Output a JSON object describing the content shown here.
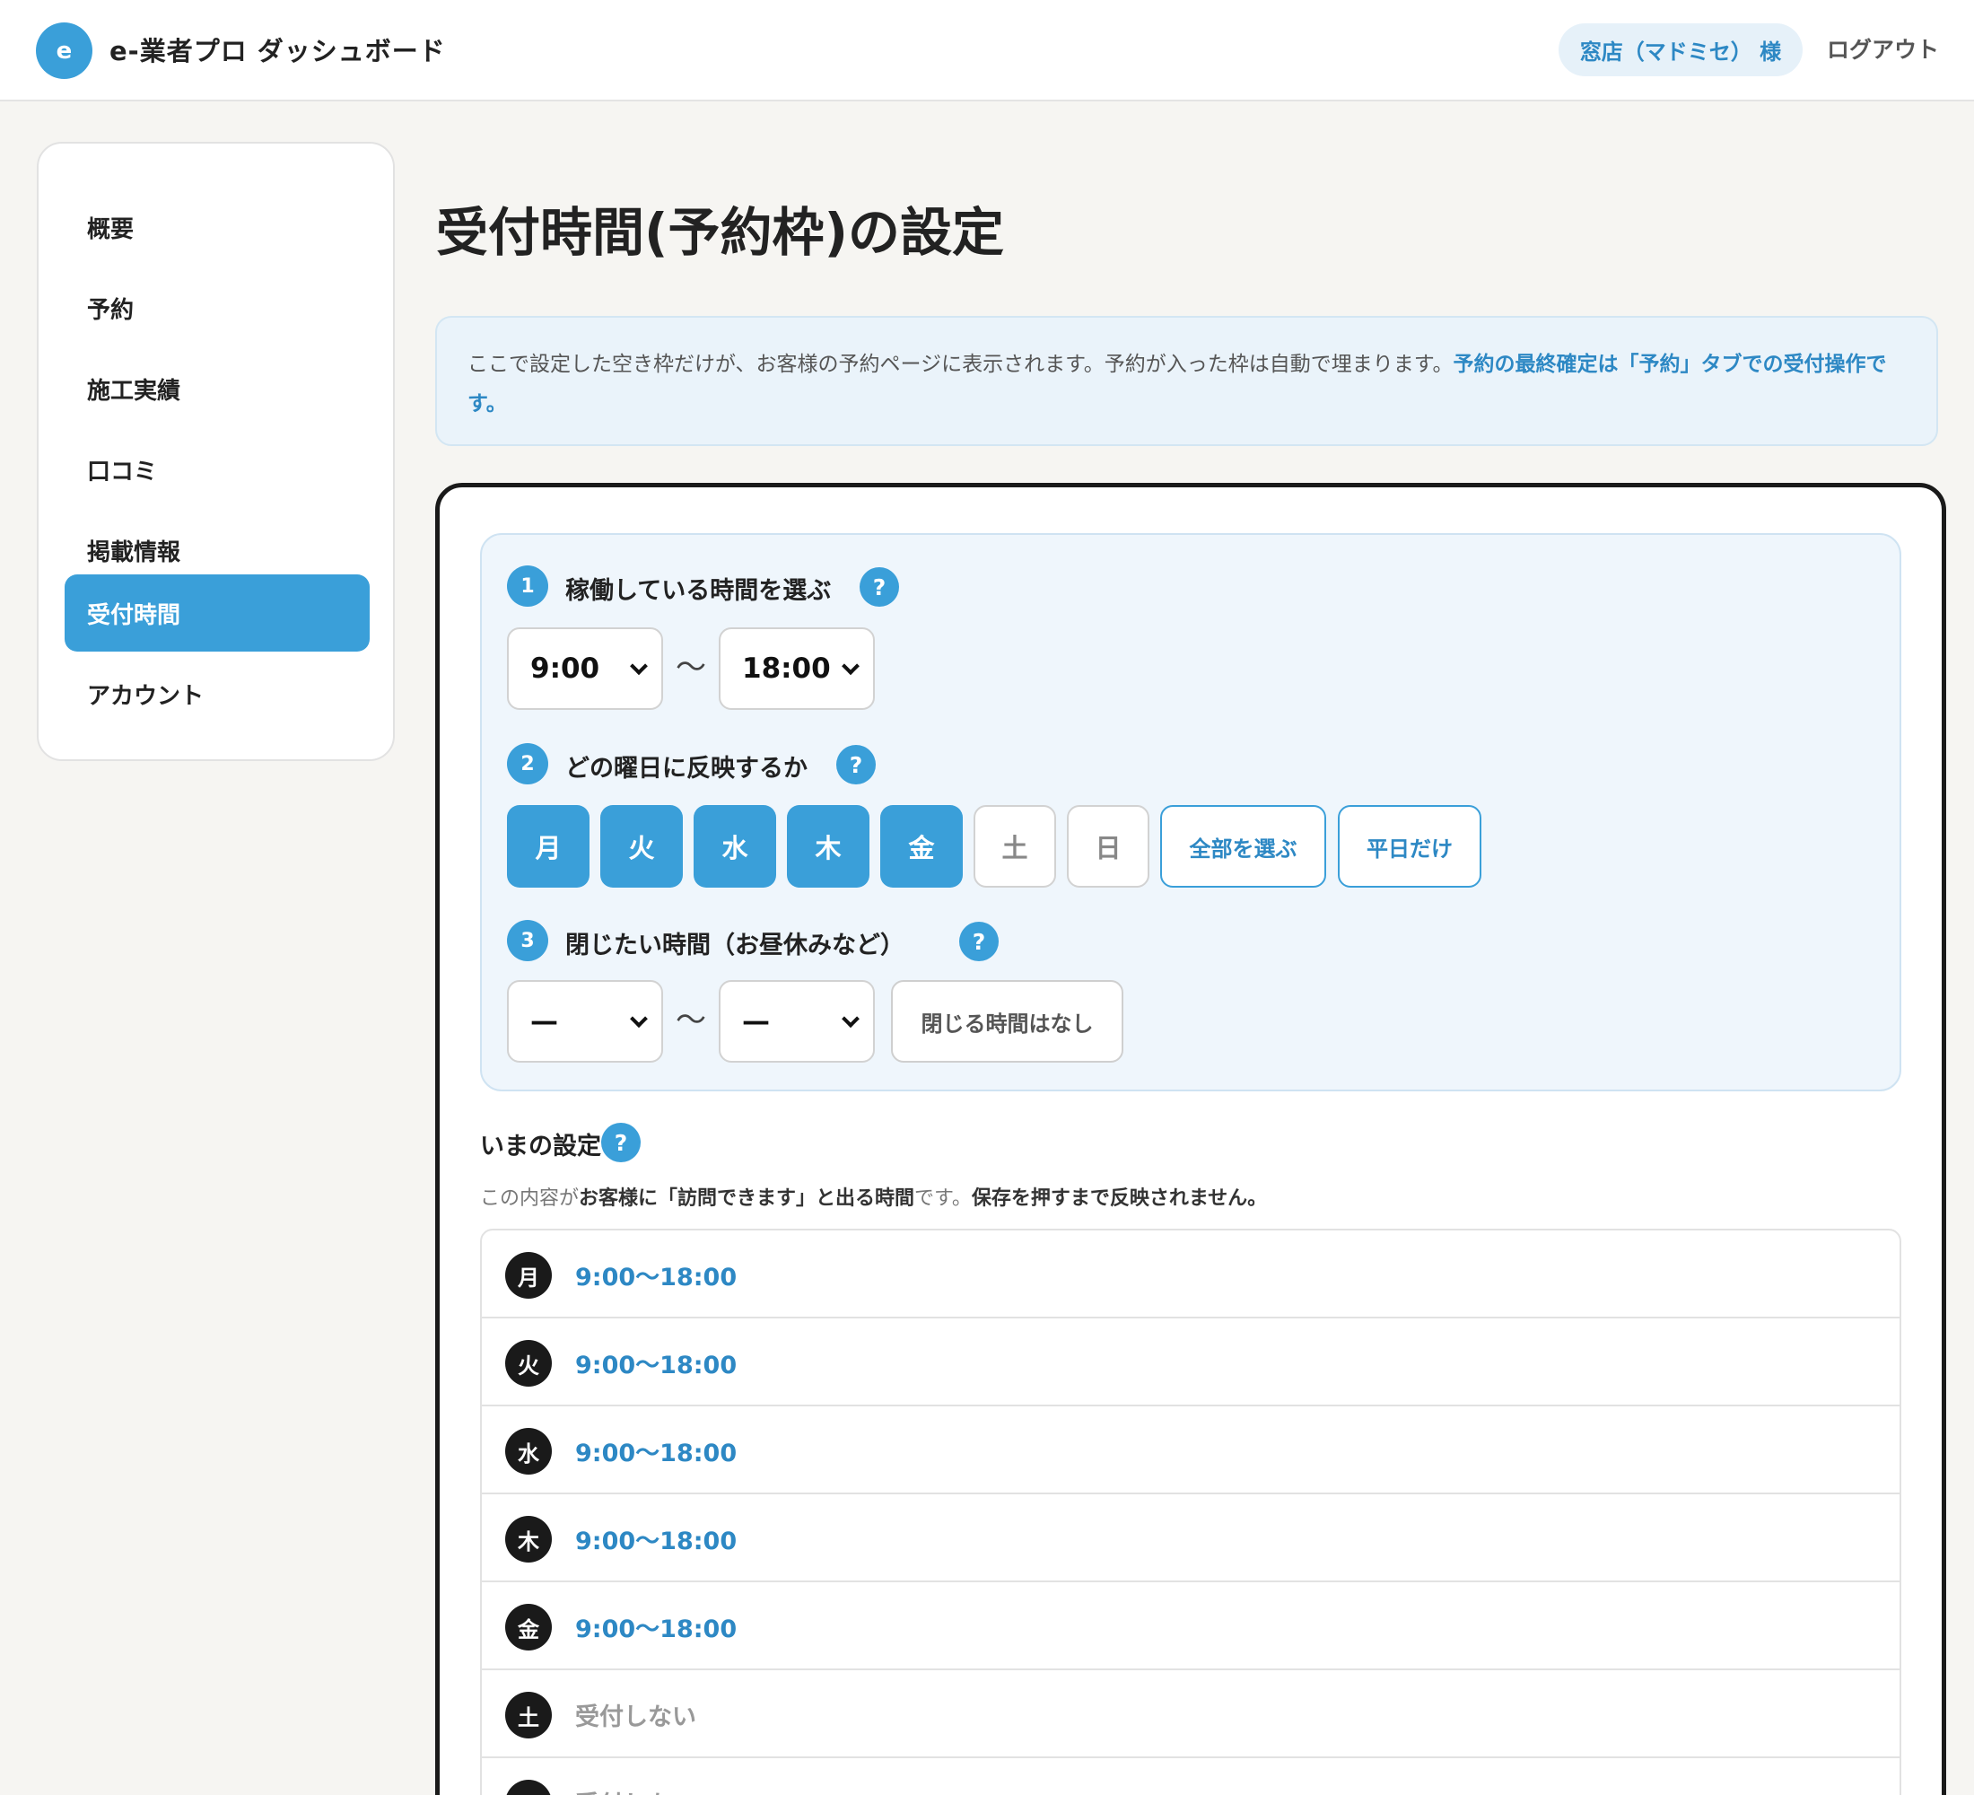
{
  "header": {
    "logo_letter": "e",
    "app_title": "e-業者プロ ダッシュボード",
    "user_label": "窓店（マドミセ） 様",
    "logout_label": "ログアウト"
  },
  "sidebar": {
    "items": [
      {
        "label": "概要",
        "active": false
      },
      {
        "label": "予約",
        "active": false
      },
      {
        "label": "施工実績",
        "active": false
      },
      {
        "label": "口コミ",
        "active": false
      },
      {
        "label": "掲載情報",
        "active": false
      },
      {
        "label": "受付時間",
        "active": true
      },
      {
        "label": "アカウント",
        "active": false
      }
    ]
  },
  "main": {
    "title": "受付時間(予約枠)の設定",
    "info": {
      "text": "ここで設定した空き枠だけが、お客様の予約ページに表示されます。予約が入った枠は自動で埋まります。",
      "strong_text": "予約の最終確定は「予約」タブでの受付操作です。"
    },
    "step1": {
      "num": "1",
      "label": "稼働している時間を選ぶ",
      "help": "?",
      "start": "9:00",
      "end": "18:00",
      "separator": "〜"
    },
    "step2": {
      "num": "2",
      "label": "どの曜日に反映するか",
      "help": "?",
      "days": [
        {
          "label": "月",
          "selected": true
        },
        {
          "label": "火",
          "selected": true
        },
        {
          "label": "水",
          "selected": true
        },
        {
          "label": "木",
          "selected": true
        },
        {
          "label": "金",
          "selected": true
        },
        {
          "label": "土",
          "selected": false
        },
        {
          "label": "日",
          "selected": false
        }
      ],
      "select_all": "全部を選ぶ",
      "weekdays_only": "平日だけ"
    },
    "step3": {
      "num": "3",
      "label": "閉じたい時間（お昼休みなど）",
      "help": "?",
      "start": "—",
      "end": "—",
      "separator": "〜",
      "none_button": "閉じる時間はなし"
    },
    "current": {
      "title": "いまの設定",
      "help": "?",
      "note_prefix": "この内容が",
      "note_bold1": "お客様に「訪問できます」と出る時間",
      "note_mid": "です。",
      "note_bold2": "保存を押すまで反映されません。",
      "rows": [
        {
          "day": "月",
          "time": "9:00〜18:00"
        },
        {
          "day": "火",
          "time": "9:00〜18:00"
        },
        {
          "day": "水",
          "time": "9:00〜18:00"
        },
        {
          "day": "木",
          "time": "9:00〜18:00"
        },
        {
          "day": "金",
          "time": "9:00〜18:00"
        },
        {
          "day": "土",
          "time": "受付しない"
        },
        {
          "day": "日",
          "time": "受付しない"
        }
      ]
    }
  },
  "colors": {
    "accent": "#3a9fd9",
    "accent_text": "#2d88c4",
    "background": "#f6f5f2"
  }
}
